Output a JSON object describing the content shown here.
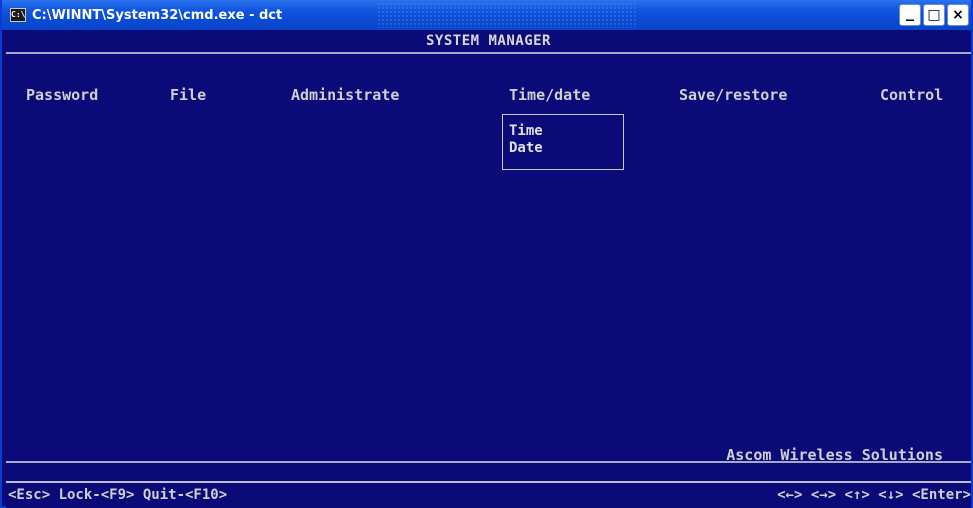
{
  "window": {
    "title": "C:\\WINNT\\System32\\cmd.exe - dct",
    "icon_label": "C:\\",
    "buttons": {
      "minimize": "_",
      "maximize": "□",
      "close": "×"
    }
  },
  "header": {
    "title": "SYSTEM MANAGER"
  },
  "menu": {
    "items": [
      {
        "label": "Password"
      },
      {
        "label": "File"
      },
      {
        "label": "Administrate"
      },
      {
        "label": "Time/date"
      },
      {
        "label": "Save/restore"
      },
      {
        "label": "Control"
      }
    ]
  },
  "dropdown": {
    "items": [
      {
        "label": "Time"
      },
      {
        "label": "Date"
      }
    ]
  },
  "brand": {
    "text": "Ascom Wireless Solutions"
  },
  "status": {
    "left": "<Esc> Lock-<F9> Quit-<F10>",
    "right": "<←> <→> <↑> <↓> <Enter>"
  },
  "colors": {
    "console_bg": "#0a0a78",
    "console_fg": "#c8c8c8",
    "titlebar": "#0a4ad3"
  }
}
